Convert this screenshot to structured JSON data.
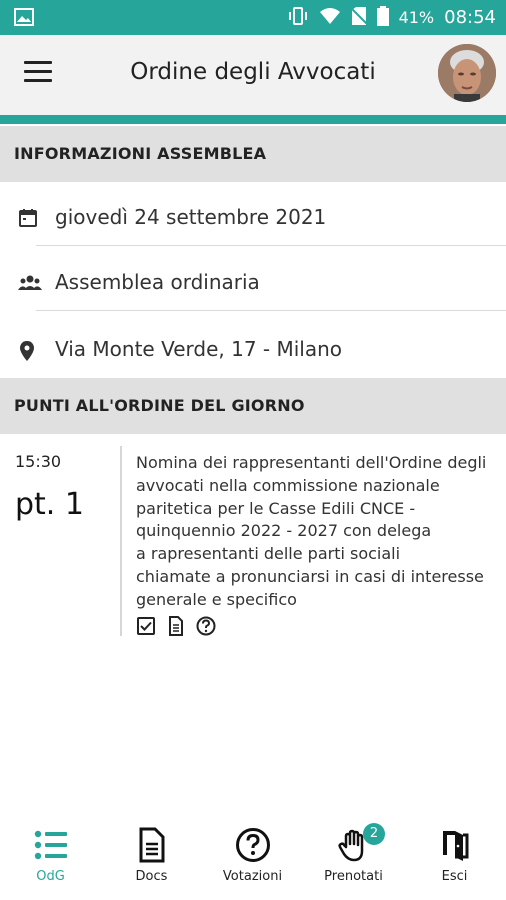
{
  "status_bar": {
    "battery": "41%",
    "time": "08:54"
  },
  "app_bar": {
    "title": "Ordine degli Avvocati"
  },
  "info_section": {
    "header": "INFORMAZIONI ASSEMBLEA",
    "date": "giovedì 24 settembre 2021",
    "type": "Assemblea ordinaria",
    "location": "Via Monte Verde, 17 - Milano"
  },
  "agenda_section": {
    "header": "PUNTI ALL'ORDINE DEL GIORNO",
    "items": [
      {
        "time": "15:30",
        "point": "pt. 1",
        "lines": [
          "Nomina dei rappresentanti dell'Ordine degli",
          "avvocati nella commissione nazionale",
          "paritetica per le Casse Edili CNCE -",
          "quinquennio 2022 - 2027 con delega",
          "a rapresentanti delle parti sociali",
          "chiamate a pronunciarsi in casi di interesse",
          "generale e specifico"
        ]
      }
    ]
  },
  "bottom_nav": {
    "odg": "OdG",
    "docs": "Docs",
    "votazioni": "Votazioni",
    "prenotati": "Prenotati",
    "prenotati_badge": "2",
    "esci": "Esci"
  },
  "colors": {
    "accent": "#26a69a",
    "section_bg": "#e0e0e0",
    "appbar_bg": "#f2f2f2"
  }
}
